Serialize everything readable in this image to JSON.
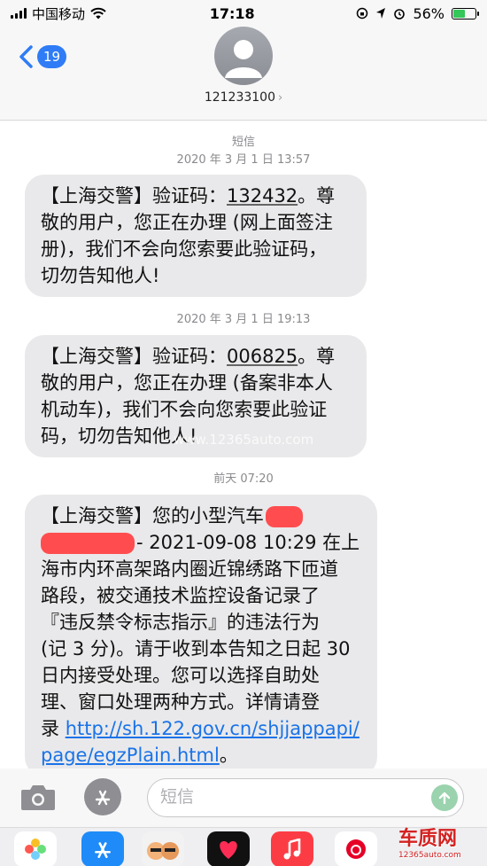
{
  "status_bar": {
    "carrier": "中国移动",
    "time": "17:18",
    "battery": "56%",
    "battery_level": 0.56
  },
  "header": {
    "back_badge": "19",
    "contact_name": "121233100",
    "name_chevron": "›"
  },
  "messages": {
    "service_label": "短信",
    "stamp1": "2020 年 3 月 1 日 13:57",
    "msg1": {
      "line1_prefix": "【上海交警】验证码：",
      "line1_code": "132432",
      "line1_suffix": "。尊",
      "line2": "敬的用户，您正在办理 (网上面签注",
      "line3": "册)，我们不会向您索要此验证码，",
      "line4": "切勿告知他人!"
    },
    "stamp2": "2020 年 3 月 1 日 19:13",
    "msg2": {
      "line1_prefix": "【上海交警】验证码：",
      "line1_code": "006825",
      "line1_suffix": "。尊",
      "line2": "敬的用户，您正在办理 (备案非本人",
      "line3": "机动车)，我们不会向您索要此验证",
      "line4": "码，切勿告知他人!",
      "watermark": "www.12365auto.com"
    },
    "stamp3": "前天 07:20",
    "msg3": {
      "line1": "【上海交警】您的小型汽车",
      "line2": "- 2021-09-08 10:29 在上",
      "line3": "海市内环高架路内圈近锦绣路下匝道",
      "line4": "路段，被交通技术监控设备记录了",
      "line5": "『违反禁令标志指示』的违法行为",
      "line6": "(记 3 分)。请于收到本告知之日起 30",
      "line7": "日内接受处理。您可以选择自助处",
      "line8": "理、窗口处理两种方式。详情请登",
      "line9_prefix": "录 ",
      "line9_link": "http://sh.122.gov.cn/shjjappapi/",
      "line10_link": "page/egzPlain.html",
      "line10_suffix": "。"
    }
  },
  "input": {
    "placeholder": "短信"
  },
  "app_drawer": {
    "watermark_title": "车质网",
    "watermark_url": "12365auto.com"
  },
  "colors": {
    "accent": "#2f7cf6",
    "bubble": "#e9e9eb",
    "link": "#1a73e8",
    "redaction": "#ff4d4f"
  }
}
